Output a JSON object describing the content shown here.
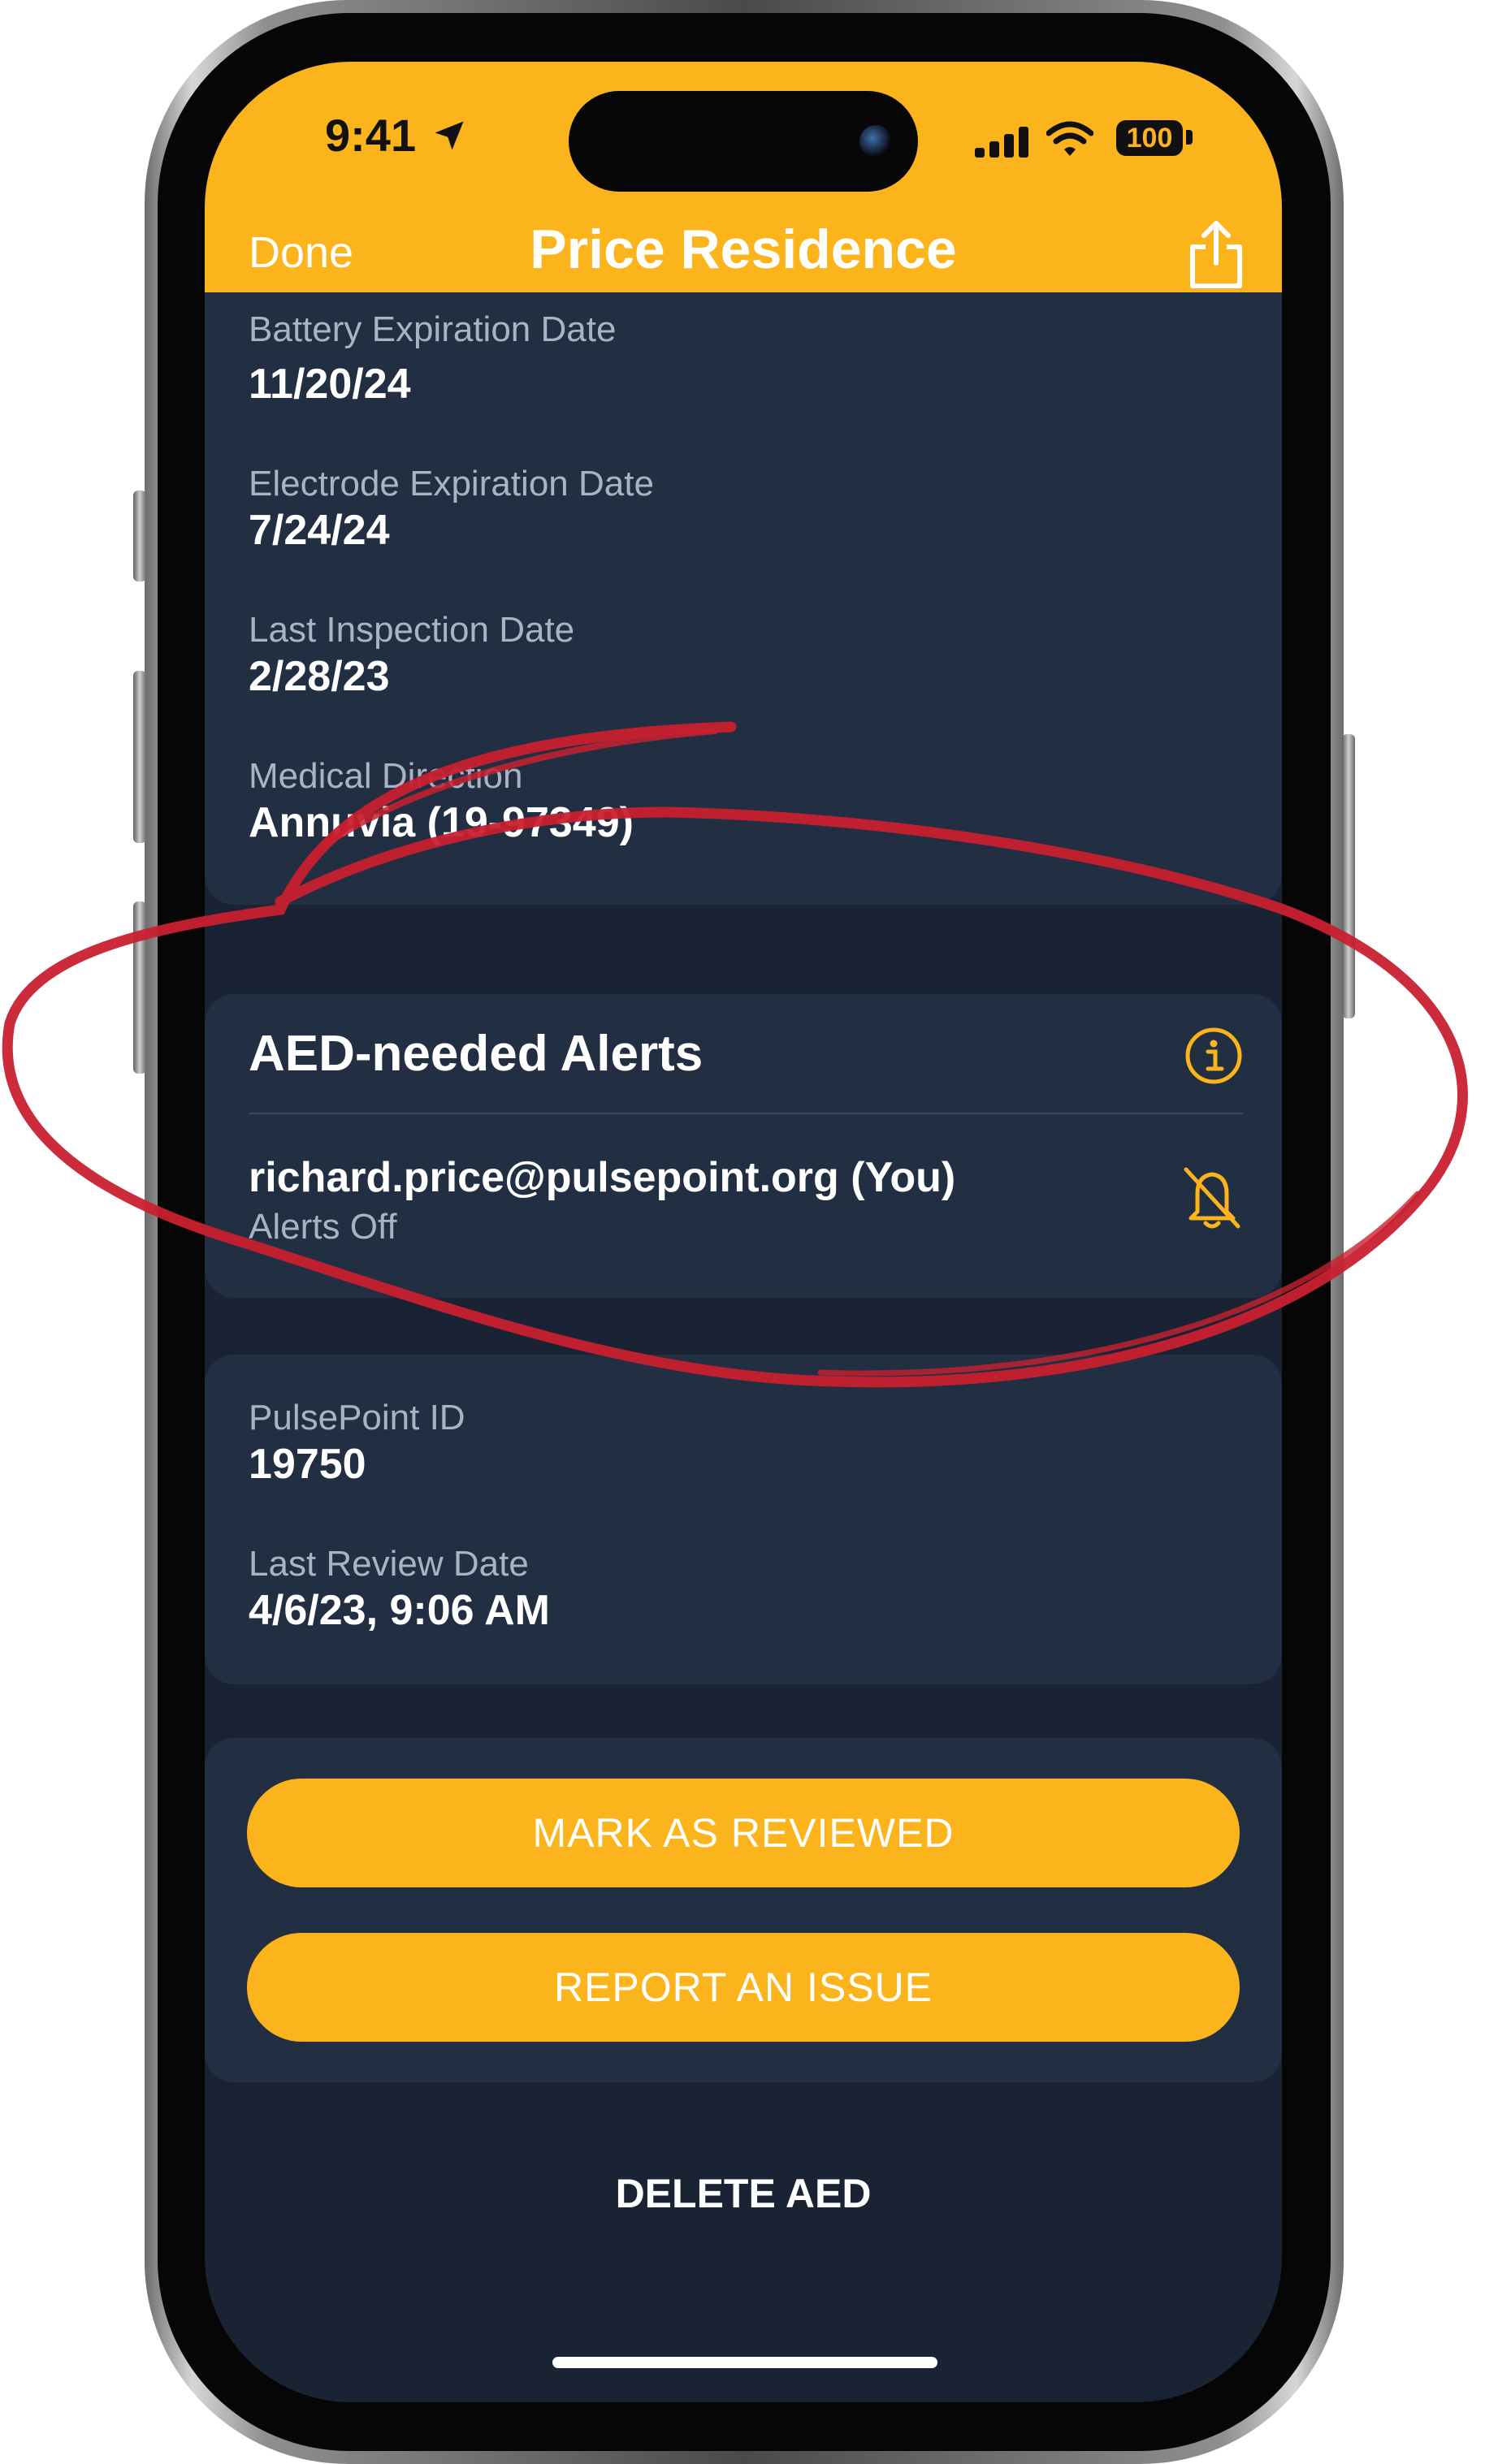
{
  "status_bar": {
    "time": "9:41",
    "battery": "100"
  },
  "nav": {
    "done_label": "Done",
    "title": "Price Residence",
    "share_icon": "share-icon"
  },
  "details": {
    "battery_label_clipped": "Battery Expiration Date",
    "battery_value": "11/20/24",
    "electrode_label": "Electrode Expiration Date",
    "electrode_value": "7/24/24",
    "inspection_label": "Last Inspection Date",
    "inspection_value": "2/28/23",
    "medical_label": "Medical Direction",
    "medical_value": "Annuvia (19-97349)"
  },
  "alerts": {
    "title": "AED-needed Alerts",
    "email": "richard.price@pulsepoint.org (You)",
    "status": "Alerts Off"
  },
  "info": {
    "id_label": "PulsePoint ID",
    "id_value": "19750",
    "review_label": "Last Review Date",
    "review_value": "4/6/23, 9:06 AM"
  },
  "actions": {
    "mark_reviewed": "MARK AS REVIEWED",
    "report_issue": "REPORT AN ISSUE",
    "delete": "DELETE AED"
  },
  "colors": {
    "accent": "#fbb41b",
    "background": "#1a2333",
    "card": "#222e42",
    "annotation": "#c8202f"
  }
}
